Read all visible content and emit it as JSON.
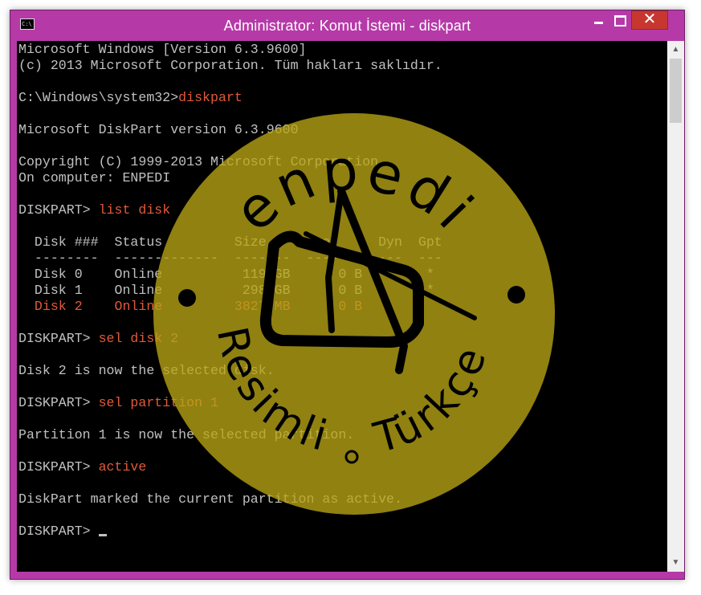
{
  "window": {
    "title": "Administrator: Komut İstemi - diskpart",
    "icon": "console-icon",
    "buttons": {
      "minimize": "minimize",
      "maximize": "maximize",
      "close": "✕"
    },
    "accent_color": "#b53aa7"
  },
  "console": {
    "lines": [
      {
        "text": "Microsoft Windows [Version 6.3.9600]"
      },
      {
        "text": "(c) 2013 Microsoft Corporation. Tüm hakları saklıdır."
      },
      {
        "text": ""
      },
      {
        "prompt": "C:\\Windows\\system32>",
        "cmd": "diskpart"
      },
      {
        "text": ""
      },
      {
        "text": "Microsoft DiskPart version 6.3.9600"
      },
      {
        "text": ""
      },
      {
        "text": "Copyright (C) 1999-2013 Microsoft Corporation."
      },
      {
        "text": "On computer: ENPEDI"
      },
      {
        "text": ""
      },
      {
        "prompt": "DISKPART> ",
        "cmd": "list disk"
      },
      {
        "text": ""
      },
      {
        "text": "  Disk ###  Status         Size     Free     Dyn  Gpt"
      },
      {
        "text": "  --------  -------------  -------  -------  ---  ---"
      },
      {
        "text": "  Disk 0    Online          119 GB      0 B        *"
      },
      {
        "text": "  Disk 1    Online          298 GB      0 B        *"
      },
      {
        "text": "  Disk 2    Online         3827 MB      0 B",
        "highlight": true
      },
      {
        "text": ""
      },
      {
        "prompt": "DISKPART> ",
        "cmd": "sel disk 2"
      },
      {
        "text": ""
      },
      {
        "text": "Disk 2 is now the selected disk."
      },
      {
        "text": ""
      },
      {
        "prompt": "DISKPART> ",
        "cmd": "sel partition 1"
      },
      {
        "text": ""
      },
      {
        "text": "Partition 1 is now the selected partition."
      },
      {
        "text": ""
      },
      {
        "prompt": "DISKPART> ",
        "cmd": "active"
      },
      {
        "text": ""
      },
      {
        "text": "DiskPart marked the current partition as active."
      },
      {
        "text": ""
      },
      {
        "prompt": "DISKPART> ",
        "cursor": true
      }
    ],
    "text_color": "#c0c0c0",
    "command_color": "#e05a3a",
    "background": "#000000"
  },
  "watermark": {
    "top_text": "enpedi",
    "bottom_left_text": "Resimli",
    "bottom_right_text": "Türkçe",
    "color": "#b8a516"
  },
  "scrollbar": {
    "up": "▲",
    "down": "▼"
  }
}
